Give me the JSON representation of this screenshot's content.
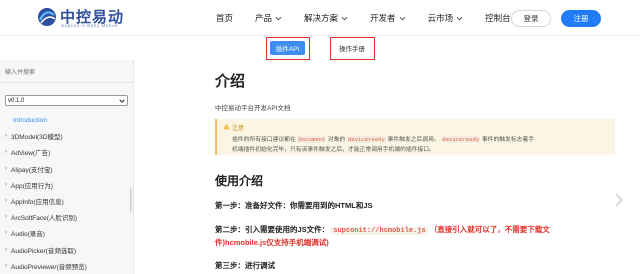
{
  "header": {
    "logo_title": "中控易动",
    "logo_subtitle": "Supcon-it Easy Mobile",
    "nav": [
      {
        "label": "首页",
        "has_dropdown": false
      },
      {
        "label": "产品",
        "has_dropdown": true
      },
      {
        "label": "解决方案",
        "has_dropdown": true
      },
      {
        "label": "开发者",
        "has_dropdown": true
      },
      {
        "label": "云市场",
        "has_dropdown": true
      },
      {
        "label": "控制台",
        "has_dropdown": true
      }
    ],
    "login_label": "登录",
    "register_label": "注册",
    "brand_color": "#1f7cf5"
  },
  "subtabs": {
    "api_label": "插件API",
    "manual_label": "操作手册"
  },
  "sidebar": {
    "search_placeholder": "输入并搜索",
    "version": "v0.1.0",
    "items": [
      {
        "label": "Introduction",
        "active": true
      },
      {
        "label": "3DModel(3D模型)"
      },
      {
        "label": "AdView(广告)"
      },
      {
        "label": "Alipay(支付宝)"
      },
      {
        "label": "App(应用行为)"
      },
      {
        "label": "AppInfo(应用信息)"
      },
      {
        "label": "ArcSoftFace(人脸识别)"
      },
      {
        "label": "Audio(录音)"
      },
      {
        "label": "AudioPicker(音频选取)"
      },
      {
        "label": "AudioPreviewer(音频预览)"
      }
    ]
  },
  "content": {
    "title": "介绍",
    "description": "中控易动平台开发API文档",
    "note": {
      "label": "注意",
      "line1_a": "插件的所有接口建议都在",
      "line1_code1": "Document",
      "line1_b": "对象的",
      "line1_code2": "deviceready",
      "line1_c": "事件触发之后调用。",
      "line1_code3": "deviceready",
      "line1_d": "事件的触发标志着手",
      "line2": "机端插件初始化完毕，只有该事件触发之后，才能正常调用手机端的插件接口。"
    },
    "section_title": "使用介绍",
    "step1": "第一步：准备好文件：你需要用到的HTML和JS",
    "step2_a": "第二步：引入需要使用的JS文件：",
    "step2_code": "supconit://hcmobile.js",
    "step2_red1": "（直接引入就可以了，不需要下载文",
    "step2_red2": "件)hcmobile.js仅支持手机端调试)",
    "step3": "第三步：进行调试"
  },
  "colors": {
    "accent": "#3e8df0",
    "highlight_border": "#e0312a",
    "note_background": "#fbf5e3",
    "note_accent": "#f0c552"
  }
}
